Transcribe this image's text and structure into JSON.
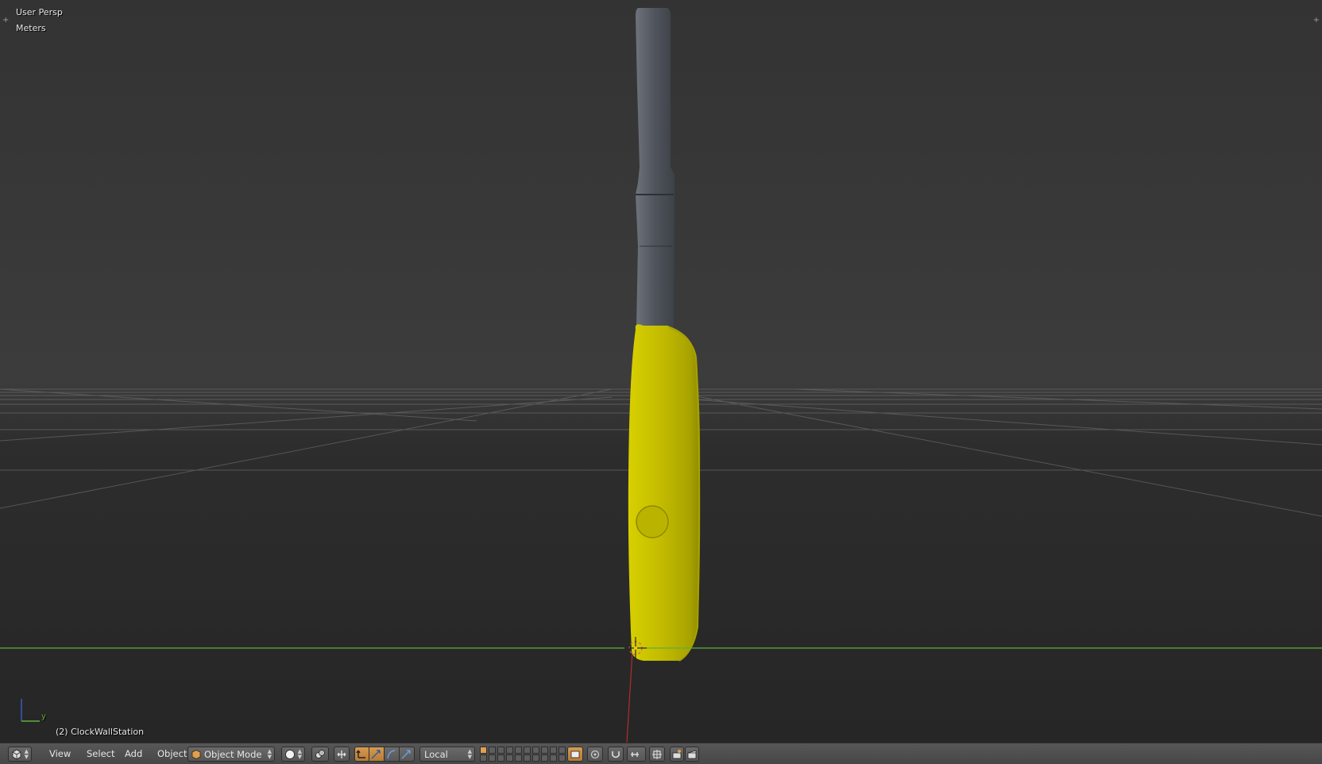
{
  "viewport": {
    "perspective_label": "User Persp",
    "units_label": "Meters",
    "active_object_label": "(2) ClockWallStation",
    "axis_labels": {
      "y": "y"
    },
    "colors": {
      "yellow_body": "#c8c000",
      "grey_body": "#4e535c",
      "x_axis_line": "#5fae3c",
      "z_axis_line": "#b32c2c",
      "grid": "#8a8a8a"
    }
  },
  "header": {
    "editor_icon": "3d-view-icon",
    "menus": [
      "View",
      "Select",
      "Add",
      "Object"
    ],
    "mode": {
      "icon": "object-mode-cube-icon",
      "value": "Object Mode"
    },
    "shading_icon": "solid-sphere-icon",
    "pivot_icon": "pivot-point-icon",
    "manipulator_icons": [
      "manipulator-toggle-icon",
      "translate-icon",
      "rotate-icon",
      "scale-icon"
    ],
    "orientation": {
      "value": "Local"
    },
    "snap_icons": [
      "lock-camera-icon",
      "proportional-edit-icon",
      "snap-magnet-icon",
      "snap-element-icon",
      "render-icon",
      "opengl-render-icon"
    ]
  }
}
